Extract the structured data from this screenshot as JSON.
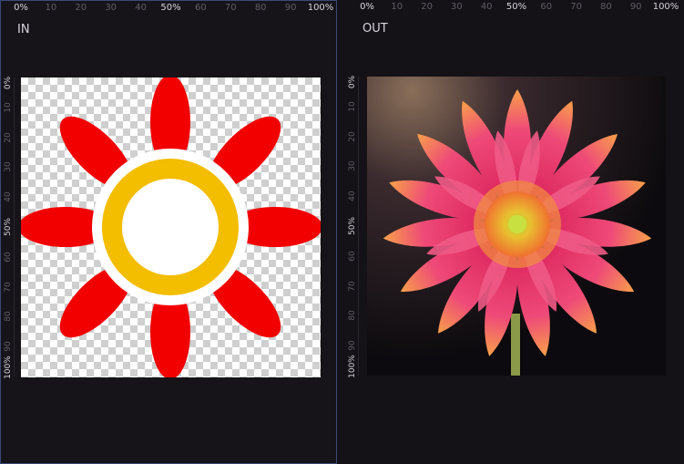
{
  "panels": {
    "input": {
      "label": "IN"
    },
    "output": {
      "label": "OUT"
    }
  },
  "ruler": {
    "top_ticks": [
      "0%",
      "10",
      "20",
      "30",
      "40",
      "50%",
      "60",
      "70",
      "80",
      "90",
      "100%"
    ],
    "left_ticks": [
      "0%",
      "10",
      "20",
      "30",
      "40",
      "50%",
      "60",
      "70",
      "80",
      "90",
      "100%"
    ]
  },
  "colors": {
    "petal_red": "#f20000",
    "ring_yellow": "#f3bd00",
    "panel_border": "#3a4a7a",
    "flower_pink": "#e8306a"
  }
}
